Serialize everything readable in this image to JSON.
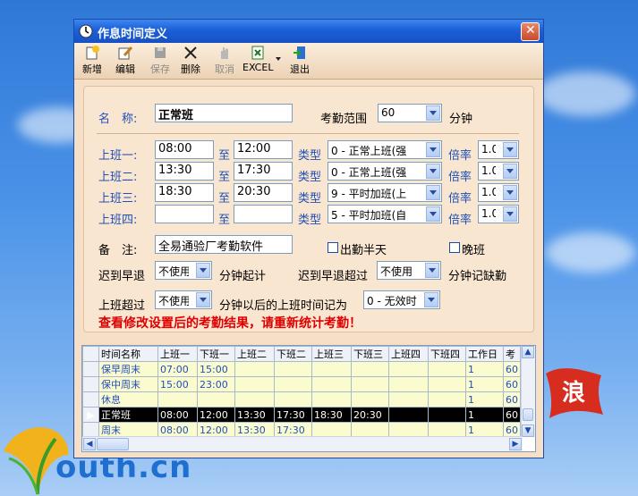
{
  "window": {
    "title": "作息时间定义"
  },
  "toolbar": {
    "new": "新增",
    "edit": "编辑",
    "save": "保存",
    "delete": "删除",
    "cancel": "取消",
    "excel": "EXCEL",
    "exit": "退出"
  },
  "form": {
    "name_label": "名　称:",
    "name_value": "正常班",
    "range_label": "考勤范围",
    "range_value": "60",
    "range_unit": "分钟",
    "shifts": [
      {
        "label": "上班一:",
        "start": "08:00",
        "to": "至",
        "end": "12:00",
        "type_label": "类型",
        "type": "0 - 正常上班(强",
        "rate_label": "倍率",
        "rate": "1.0"
      },
      {
        "label": "上班二:",
        "start": "13:30",
        "to": "至",
        "end": "17:30",
        "type_label": "类型",
        "type": "0 - 正常上班(强",
        "rate_label": "倍率",
        "rate": "1.0"
      },
      {
        "label": "上班三:",
        "start": "18:30",
        "to": "至",
        "end": "20:30",
        "type_label": "类型",
        "type": "9 - 平时加班(上",
        "rate_label": "倍率",
        "rate": "1.0"
      },
      {
        "label": "上班四:",
        "start": "",
        "to": "至",
        "end": "",
        "type_label": "类型",
        "type": "5 - 平时加班(自",
        "rate_label": "倍率",
        "rate": "1.0"
      }
    ],
    "remark_label": "备　注:",
    "remark_value": "全易通验厂考勤软件",
    "half_day_label": "出勤半天",
    "half_day_checked": false,
    "late_shift_label": "晚班",
    "late_shift_checked": false,
    "late_early_label": "迟到早退",
    "late_early_value": "不使用",
    "late_early_suffix": "分钟起计",
    "late_exceed_label": "迟到早退超过",
    "late_exceed_value": "不使用",
    "late_exceed_suffix": "分钟记缺勤",
    "work_exceed_label": "上班超过",
    "work_exceed_value": "不使用",
    "work_exceed_suffix": "分钟以后的上班时间记为",
    "work_exceed_result": "0 - 无效时",
    "warning": "查看修改设置后的考勤结果，请重新统计考勤！"
  },
  "grid": {
    "columns": [
      "时间名称",
      "上班一",
      "下班一",
      "上班二",
      "下班二",
      "上班三",
      "下班三",
      "上班四",
      "下班四",
      "工作日",
      "考"
    ],
    "rows": [
      {
        "selected": false,
        "cells": [
          "保早周末",
          "07:00",
          "15:00",
          "",
          "",
          "",
          "",
          "",
          "",
          "1",
          "60"
        ]
      },
      {
        "selected": false,
        "cells": [
          "保中周末",
          "15:00",
          "23:00",
          "",
          "",
          "",
          "",
          "",
          "",
          "1",
          "60"
        ]
      },
      {
        "selected": false,
        "cells": [
          "休息",
          "",
          "",
          "",
          "",
          "",
          "",
          "",
          "",
          "1",
          "60"
        ]
      },
      {
        "selected": true,
        "cells": [
          "正常班",
          "08:00",
          "12:00",
          "13:30",
          "17:30",
          "18:30",
          "20:30",
          "",
          "",
          "1",
          "60"
        ]
      },
      {
        "selected": false,
        "cells": [
          "周末",
          "08:00",
          "12:00",
          "13:30",
          "17:30",
          "",
          "",
          "",
          "",
          "1",
          "60"
        ]
      }
    ]
  },
  "background": {
    "logo_text": "outh.cn",
    "flag_text": "浪"
  }
}
